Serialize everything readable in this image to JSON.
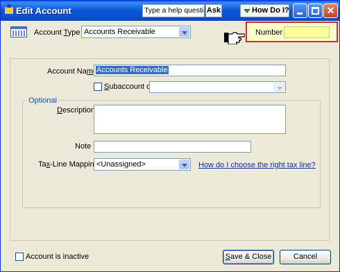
{
  "window": {
    "title": "Edit Account",
    "help_placeholder": "Type a help question",
    "ask_label": "Ask",
    "how_do_i_label": "How Do I?"
  },
  "account_type": {
    "label": "Account Type",
    "value": "Accounts Receivable"
  },
  "number": {
    "label": "Number",
    "value": ""
  },
  "form": {
    "account_name_label": "Account Name",
    "account_name_value": "Accounts Receivable",
    "subaccount_label": "Subaccount of",
    "subaccount_value": "",
    "subaccount_checked": false,
    "optional_legend": "Optional",
    "description_label": "Description",
    "description_value": "",
    "note_label": "Note",
    "note_value": "",
    "tax_line_label": "Tax-Line Mapping",
    "tax_line_value": "<Unassigned>",
    "tax_help_link": "How do I choose the right tax line?"
  },
  "footer": {
    "inactive_label": "Account is inactive",
    "inactive_checked": false,
    "save_close_label": "Save & Close",
    "cancel_label": "Cancel"
  },
  "colors": {
    "title_bar": "#0a5fe4",
    "number_highlight_border": "#d9262b",
    "number_highlight_bg": "#ffffcc",
    "link": "#0a2fa8"
  }
}
